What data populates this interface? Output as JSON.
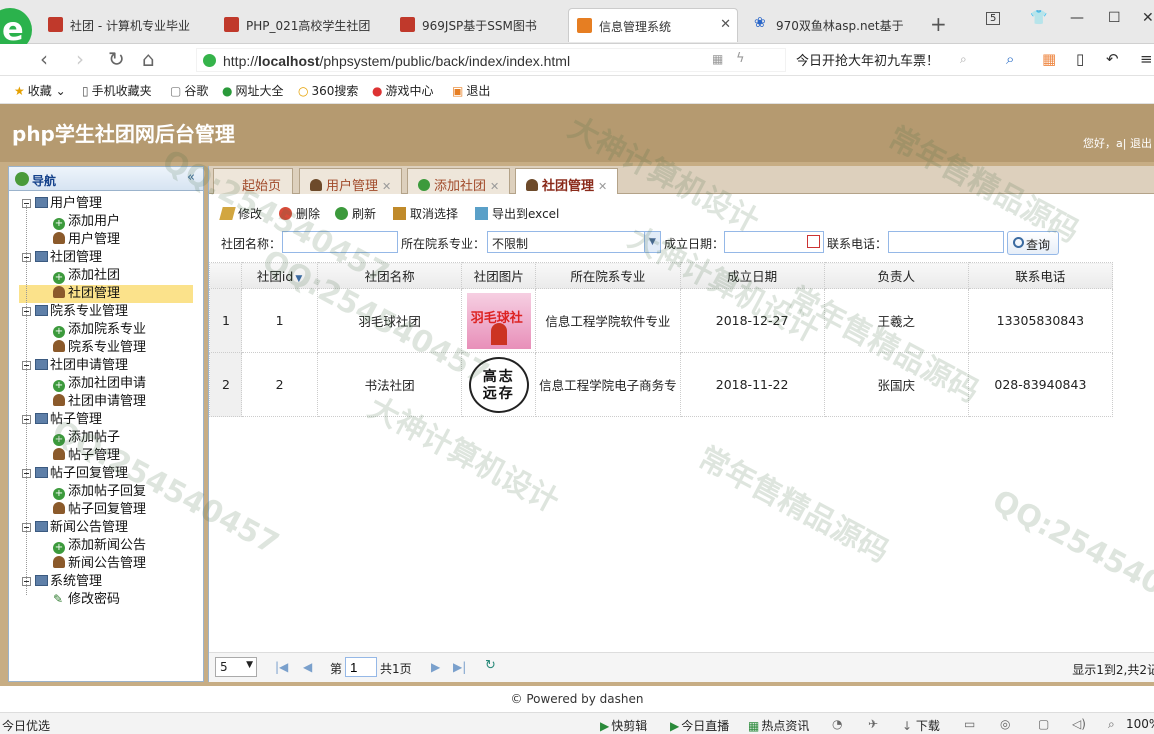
{
  "browser": {
    "tabs": [
      {
        "label": "社团 - 计算机专业毕业",
        "active": false
      },
      {
        "label": "PHP_021高校学生社团",
        "active": false
      },
      {
        "label": "969JSP基于SSM图书",
        "active": false
      },
      {
        "label": "信息管理系统",
        "active": true
      },
      {
        "label": "970双鱼林asp.net基于",
        "active": false
      }
    ],
    "tab_count_badge": "5",
    "url_prefix": "http://",
    "url_host": "localhost",
    "url_path": "/phpsystem/public/back/index/index.html",
    "promo_text": "今日开抢大年初九车票！",
    "bookmarks": [
      {
        "label": "收藏",
        "icon": "star-icon"
      },
      {
        "label": "手机收藏夹",
        "icon": "phone-icon"
      },
      {
        "label": "谷歌",
        "icon": "page-icon"
      },
      {
        "label": "网址大全",
        "icon": "globe-icon"
      },
      {
        "label": "360搜索",
        "icon": "search-icon"
      },
      {
        "label": "游戏中心",
        "icon": "game-icon"
      },
      {
        "label": "退出",
        "icon": "exit-icon"
      }
    ]
  },
  "app": {
    "title": "php学生社团网后台管理",
    "welcome": "您好，a",
    "logout": "退出"
  },
  "nav": {
    "title": "导航",
    "groups": [
      {
        "label": "用户管理",
        "children": [
          {
            "label": "添加用户",
            "type": "add"
          },
          {
            "label": "用户管理",
            "type": "user"
          }
        ]
      },
      {
        "label": "社团管理",
        "children": [
          {
            "label": "添加社团",
            "type": "add"
          },
          {
            "label": "社团管理",
            "type": "user",
            "selected": true
          }
        ]
      },
      {
        "label": "院系专业管理",
        "children": [
          {
            "label": "添加院系专业",
            "type": "add"
          },
          {
            "label": "院系专业管理",
            "type": "user"
          }
        ]
      },
      {
        "label": "社团申请管理",
        "children": [
          {
            "label": "添加社团申请",
            "type": "add"
          },
          {
            "label": "社团申请管理",
            "type": "user"
          }
        ]
      },
      {
        "label": "帖子管理",
        "children": [
          {
            "label": "添加帖子",
            "type": "add"
          },
          {
            "label": "帖子管理",
            "type": "user"
          }
        ]
      },
      {
        "label": "帖子回复管理",
        "children": [
          {
            "label": "添加帖子回复",
            "type": "add"
          },
          {
            "label": "帖子回复管理",
            "type": "user"
          }
        ]
      },
      {
        "label": "新闻公告管理",
        "children": [
          {
            "label": "添加新闻公告",
            "type": "add"
          },
          {
            "label": "新闻公告管理",
            "type": "user"
          }
        ]
      },
      {
        "label": "系统管理",
        "children": [
          {
            "label": "修改密码",
            "type": "pen"
          }
        ]
      }
    ]
  },
  "page_tabs": [
    {
      "label": "起始页",
      "icon": "",
      "closable": false
    },
    {
      "label": "用户管理",
      "icon": "user",
      "closable": true
    },
    {
      "label": "添加社团",
      "icon": "add",
      "closable": true
    },
    {
      "label": "社团管理",
      "icon": "user",
      "closable": true,
      "active": true
    }
  ],
  "toolbar": {
    "edit": "修改",
    "delete": "删除",
    "refresh": "刷新",
    "unselect": "取消选择",
    "export": "导出到excel"
  },
  "search": {
    "name_label": "社团名称：",
    "name_value": "",
    "major_label": "所在院系专业：",
    "major_value": "不限制",
    "date_label": "成立日期：",
    "date_value": "",
    "phone_label": "联系电话：",
    "phone_value": "",
    "query_button": "查询"
  },
  "table": {
    "columns": [
      "社团id",
      "社团名称",
      "社团图片",
      "所在院系专业",
      "成立日期",
      "负责人",
      "联系电话"
    ],
    "rows": [
      {
        "rownum": "1",
        "id": "1",
        "name": "羽毛球社团",
        "image_text": "羽毛球社",
        "major": "信息工程学院软件专业",
        "date": "2018-12-27",
        "leader": "王羲之",
        "phone": "13305830843"
      },
      {
        "rownum": "2",
        "id": "2",
        "name": "书法社团",
        "image_text": "高志远存",
        "major": "信息工程学院电子商务专",
        "date": "2018-11-22",
        "leader": "张国庆",
        "phone": "028-83940843"
      }
    ]
  },
  "pager": {
    "page_size": "5",
    "page_label_pre": "第",
    "page_value": "1",
    "page_label_post": "共1页",
    "info": "显示1到2,共2记"
  },
  "footer": "© Powered by dashen",
  "status": {
    "left": "今日优选",
    "items": [
      "快剪辑",
      "今日直播",
      "热点资讯",
      "下载"
    ],
    "zoom": "100%"
  },
  "watermarks": [
    "QQ:254540457",
    "大神计算机设计",
    "常年售精品源码",
    "QQ:254540457",
    "大神计算机设计",
    "常年售精品源码",
    "QQ:254540457",
    "大神计算机设计",
    "常年售精品源码",
    "QQ:254540457"
  ]
}
